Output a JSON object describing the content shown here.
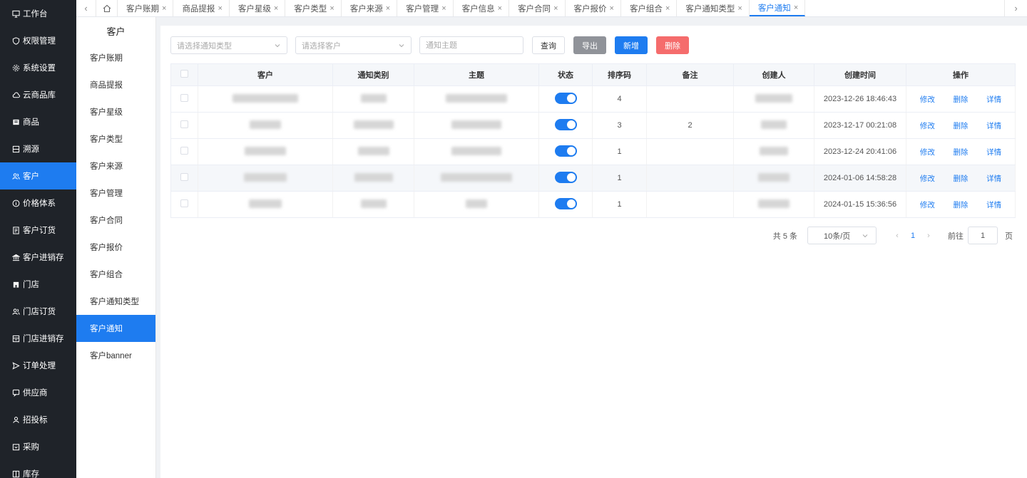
{
  "nav": {
    "items": [
      {
        "label": "工作台",
        "icon": "monitor-icon"
      },
      {
        "label": "权限管理",
        "icon": "shield-icon"
      },
      {
        "label": "系统设置",
        "icon": "gear-icon"
      },
      {
        "label": "云商品库",
        "icon": "cloud-icon"
      },
      {
        "label": "商品",
        "icon": "box-icon"
      },
      {
        "label": "溯源",
        "icon": "trace-icon"
      },
      {
        "label": "客户",
        "icon": "users-icon"
      },
      {
        "label": "价格体系",
        "icon": "info-icon"
      },
      {
        "label": "客户订货",
        "icon": "order-icon"
      },
      {
        "label": "客户进销存",
        "icon": "bank-icon"
      },
      {
        "label": "门店",
        "icon": "store-icon"
      },
      {
        "label": "门店订货",
        "icon": "users-icon"
      },
      {
        "label": "门店进销存",
        "icon": "inventory-icon"
      },
      {
        "label": "订单处理",
        "icon": "send-icon"
      },
      {
        "label": "供应商",
        "icon": "chat-icon"
      },
      {
        "label": "招投标",
        "icon": "user-icon"
      },
      {
        "label": "采购",
        "icon": "cart-icon"
      },
      {
        "label": "库存",
        "icon": "columns-icon"
      }
    ],
    "active": 6
  },
  "tabs": {
    "items": [
      "客户账期",
      "商品提报",
      "客户星级",
      "客户类型",
      "客户来源",
      "客户管理",
      "客户信息",
      "客户合同",
      "客户报价",
      "客户组合",
      "客户通知类型",
      "客户通知"
    ],
    "close_glyph": "×",
    "prev_glyph": "‹",
    "next_glyph": "›"
  },
  "subnav": {
    "title": "客户",
    "items": [
      "客户账期",
      "商品提报",
      "客户星级",
      "客户类型",
      "客户来源",
      "客户管理",
      "客户合同",
      "客户报价",
      "客户组合",
      "客户通知类型",
      "客户通知",
      "客户banner"
    ]
  },
  "filters": {
    "type_placeholder": "请选择通知类型",
    "customer_placeholder": "请选择客户",
    "subject_placeholder": "通知主题",
    "search_label": "查询",
    "export_label": "导出",
    "add_label": "新增",
    "delete_label": "删除"
  },
  "table": {
    "headers": [
      "客户",
      "通知类别",
      "主题",
      "状态",
      "排序码",
      "备注",
      "创建人",
      "创建时间",
      "操作"
    ],
    "rows": [
      {
        "sort": "4",
        "remark": "",
        "created": "2023-12-26 18:46:43",
        "status": "on"
      },
      {
        "sort": "3",
        "remark": "2",
        "created": "2023-12-17 00:21:08",
        "status": "on"
      },
      {
        "sort": "1",
        "remark": "",
        "created": "2023-12-24 20:41:06",
        "status": "on"
      },
      {
        "sort": "1",
        "remark": "",
        "created": "2024-01-06 14:58:28",
        "status": "on"
      },
      {
        "sort": "1",
        "remark": "",
        "created": "2024-01-15 15:36:56",
        "status": "on"
      }
    ],
    "actions": {
      "edit": "修改",
      "delete": "删除",
      "detail": "详情"
    }
  },
  "pagination": {
    "total": "共 5 条",
    "page_size": "10条/页",
    "current": "1",
    "goto_label": "前往",
    "goto_value": "1",
    "page_suffix": "页"
  },
  "colors": {
    "accent": "#1e7cf0",
    "danger": "#f56c6c",
    "nav_bg": "#1f2329"
  }
}
